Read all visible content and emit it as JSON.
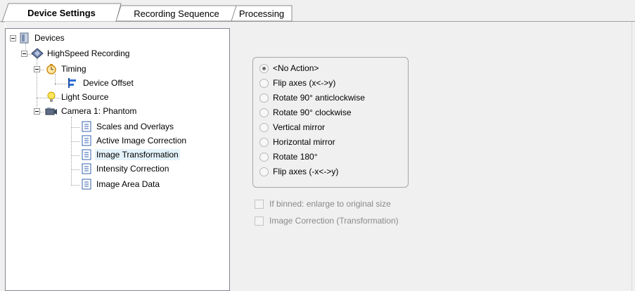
{
  "tabs": [
    {
      "label": "Device Settings",
      "active": true
    },
    {
      "label": "Recording Sequence",
      "active": false
    },
    {
      "label": "Processing",
      "active": false
    }
  ],
  "tree": {
    "root": {
      "label": "Devices",
      "icon": "device-panel-icon"
    },
    "recording": {
      "label": "HighSpeed Recording",
      "icon": "recording-diamond-icon"
    },
    "timing": {
      "label": "Timing",
      "icon": "stopwatch-icon"
    },
    "device_offset": {
      "label": "Device Offset",
      "icon": "offset-bars-icon"
    },
    "light_source": {
      "label": "Light Source",
      "icon": "light-bulb-icon"
    },
    "camera": {
      "label": "Camera 1: Phantom",
      "icon": "camera-icon"
    },
    "camera_children": [
      {
        "label": "Scales and Overlays",
        "icon": "document-lines-icon"
      },
      {
        "label": "Active Image Correction",
        "icon": "document-lines-icon"
      },
      {
        "label": "Image Transformation",
        "icon": "document-lines-icon",
        "selected": true
      },
      {
        "label": "Intensity Correction",
        "icon": "document-lines-icon"
      },
      {
        "label": "Image Area Data",
        "icon": "document-lines-icon"
      }
    ]
  },
  "transform_options": [
    {
      "label": "<No Action>",
      "checked": true
    },
    {
      "label": "Flip axes (x<->y)",
      "checked": false
    },
    {
      "label": "Rotate 90° anticlockwise",
      "checked": false
    },
    {
      "label": "Rotate 90° clockwise",
      "checked": false
    },
    {
      "label": "Vertical mirror",
      "checked": false
    },
    {
      "label": "Horizontal mirror",
      "checked": false
    },
    {
      "label": "Rotate 180°",
      "checked": false
    },
    {
      "label": "Flip axes (-x<->y)",
      "checked": false
    }
  ],
  "checkboxes": [
    {
      "label": "If binned: enlarge to original size",
      "checked": false,
      "enabled": false
    },
    {
      "label": "Image Correction (Transformation)",
      "checked": false,
      "enabled": false
    }
  ]
}
